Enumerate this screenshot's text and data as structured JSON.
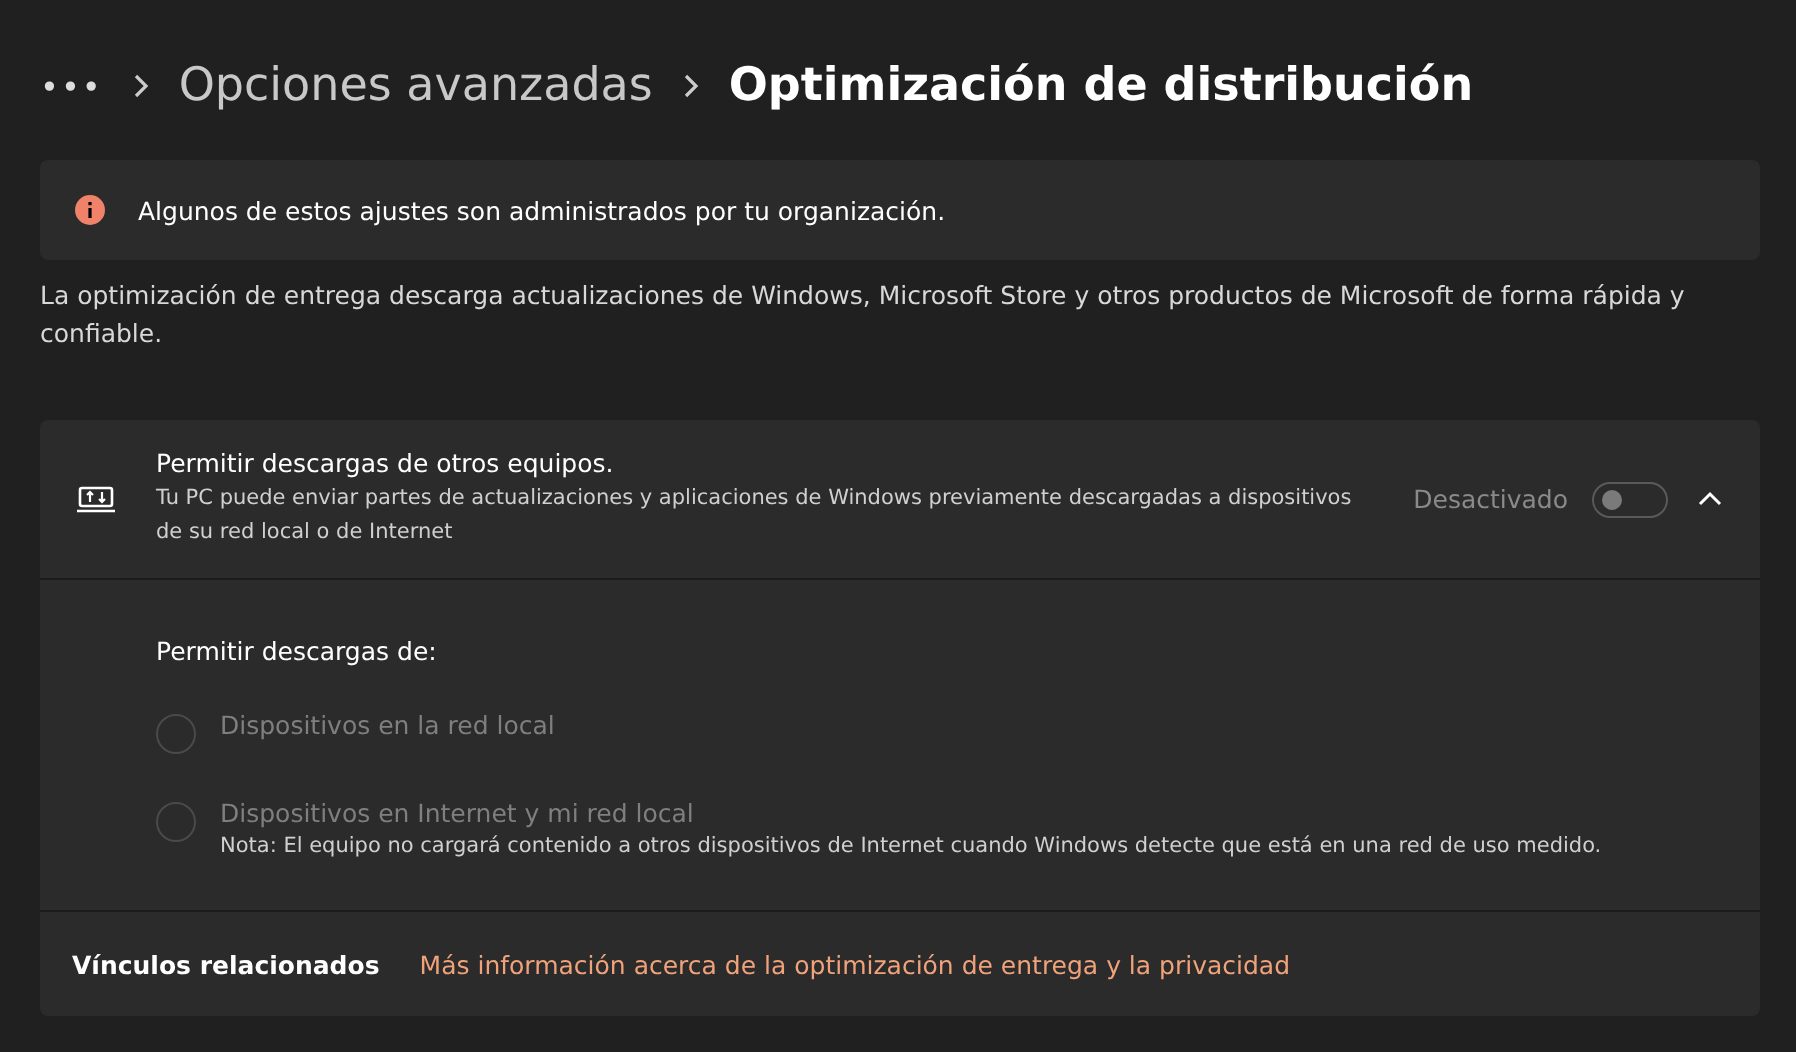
{
  "breadcrumb": {
    "more": "•••",
    "items": [
      {
        "label": "Opciones avanzadas",
        "current": false
      },
      {
        "label": "Optimización de distribución",
        "current": true
      }
    ]
  },
  "banner": {
    "text": "Algunos de estos ajustes son administrados por tu organización."
  },
  "description": "La optimización de entrega descarga actualizaciones de Windows, Microsoft Store y otros productos de Microsoft de forma rápida y confiable.",
  "setting": {
    "title": "Permitir descargas de otros equipos.",
    "subtitle": "Tu PC puede enviar partes de actualizaciones y aplicaciones de Windows previamente descargadas a dispositivos de su red local o de Internet",
    "toggle_label": "Desactivado",
    "on": false,
    "disabled": true,
    "expanded": true,
    "options_label": "Permitir descargas de:",
    "options": [
      {
        "label": "Dispositivos en la red local",
        "selected": false,
        "disabled": true
      },
      {
        "label": "Dispositivos en Internet y mi red local",
        "note": "Nota: El equipo no cargará contenido a otros dispositivos de Internet cuando Windows detecte que está en una red de uso medido.",
        "selected": false,
        "disabled": true
      }
    ]
  },
  "related": {
    "label": "Vínculos relacionados",
    "link": "Más información acerca de la optimización de entrega y la privacidad"
  }
}
